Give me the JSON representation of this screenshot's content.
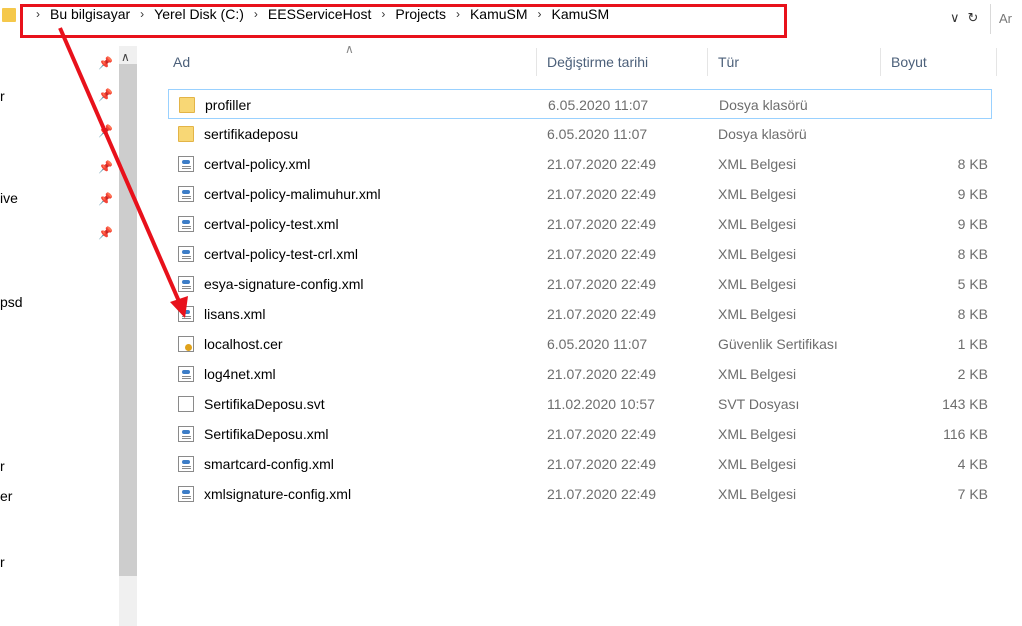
{
  "breadcrumb": [
    "Bu bilgisayar",
    "Yerel Disk (C:)",
    "EESServiceHost",
    "Projects",
    "KamuSM",
    "KamuSM"
  ],
  "address_search_placeholder": "Ar",
  "nav_items": [
    "r",
    "ive",
    "psd",
    "r",
    "er",
    "r"
  ],
  "columns": {
    "name": "Ad",
    "date": "Değiştirme tarihi",
    "type": "Tür",
    "size": "Boyut"
  },
  "files": [
    {
      "name": "profiller",
      "date": "6.05.2020 11:07",
      "type": "Dosya klasörü",
      "size": "",
      "icon": "folder-icon"
    },
    {
      "name": "sertifikadeposu",
      "date": "6.05.2020 11:07",
      "type": "Dosya klasörü",
      "size": "",
      "icon": "folder-icon"
    },
    {
      "name": "certval-policy.xml",
      "date": "21.07.2020 22:49",
      "type": "XML Belgesi",
      "size": "8 KB",
      "icon": "xml-file-icon"
    },
    {
      "name": "certval-policy-malimuhur.xml",
      "date": "21.07.2020 22:49",
      "type": "XML Belgesi",
      "size": "9 KB",
      "icon": "xml-file-icon"
    },
    {
      "name": "certval-policy-test.xml",
      "date": "21.07.2020 22:49",
      "type": "XML Belgesi",
      "size": "9 KB",
      "icon": "xml-file-icon"
    },
    {
      "name": "certval-policy-test-crl.xml",
      "date": "21.07.2020 22:49",
      "type": "XML Belgesi",
      "size": "8 KB",
      "icon": "xml-file-icon"
    },
    {
      "name": "esya-signature-config.xml",
      "date": "21.07.2020 22:49",
      "type": "XML Belgesi",
      "size": "5 KB",
      "icon": "xml-file-icon"
    },
    {
      "name": "lisans.xml",
      "date": "21.07.2020 22:49",
      "type": "XML Belgesi",
      "size": "8 KB",
      "icon": "xml-file-icon"
    },
    {
      "name": "localhost.cer",
      "date": "6.05.2020 11:07",
      "type": "Güvenlik Sertifikası",
      "size": "1 KB",
      "icon": "certificate-icon"
    },
    {
      "name": "log4net.xml",
      "date": "21.07.2020 22:49",
      "type": "XML Belgesi",
      "size": "2 KB",
      "icon": "xml-file-icon"
    },
    {
      "name": "SertifikaDeposu.svt",
      "date": "11.02.2020 10:57",
      "type": "SVT Dosyası",
      "size": "143 KB",
      "icon": "file-icon"
    },
    {
      "name": "SertifikaDeposu.xml",
      "date": "21.07.2020 22:49",
      "type": "XML Belgesi",
      "size": "116 KB",
      "icon": "xml-file-icon"
    },
    {
      "name": "smartcard-config.xml",
      "date": "21.07.2020 22:49",
      "type": "XML Belgesi",
      "size": "4 KB",
      "icon": "xml-file-icon"
    },
    {
      "name": "xmlsignature-config.xml",
      "date": "21.07.2020 22:49",
      "type": "XML Belgesi",
      "size": "7 KB",
      "icon": "xml-file-icon"
    }
  ],
  "colors": {
    "highlight_border": "#e8111b",
    "arrow": "#e8111b",
    "selection": "#99d1ff",
    "header_text": "#4c607a"
  }
}
